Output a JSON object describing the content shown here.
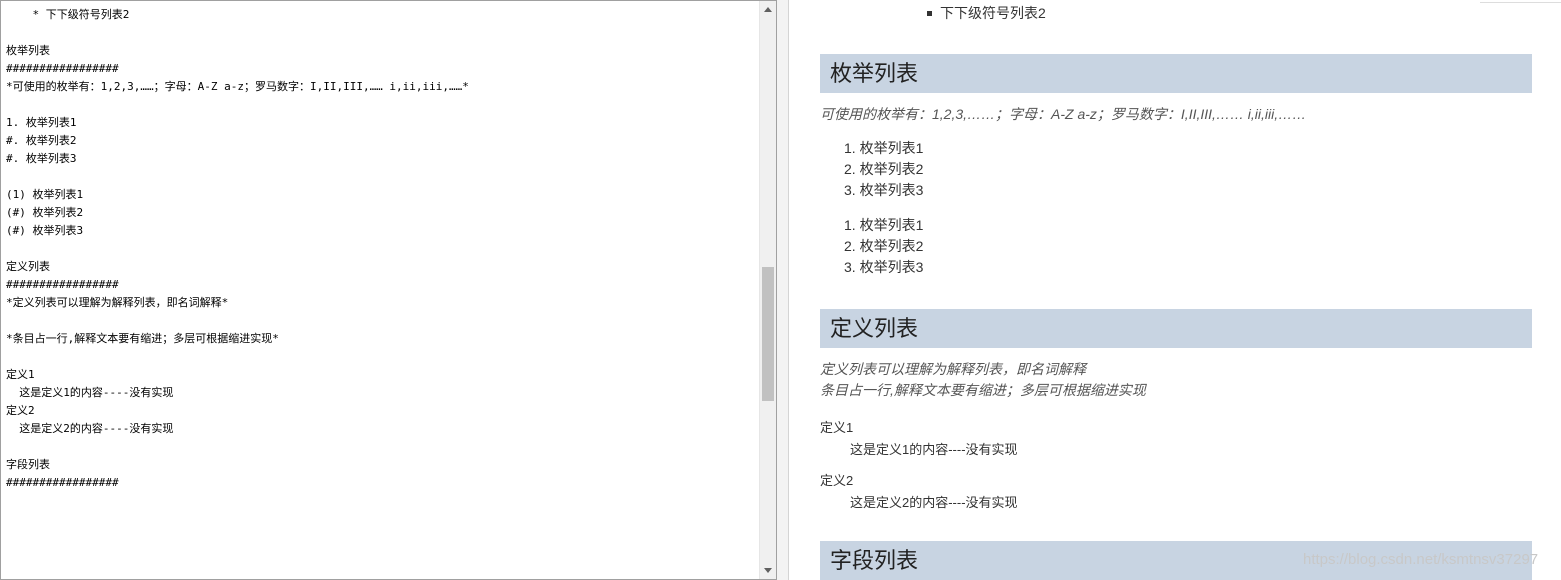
{
  "editor": {
    "lines": [
      "    * 下下级符号列表2",
      "",
      "枚举列表",
      "#################",
      "*可使用的枚举有：1,2,3,……；字母：A-Z a-z；罗马数字：I,II,III,…… i,ii,iii,……*",
      "",
      "1. 枚举列表1",
      "#. 枚举列表2",
      "#. 枚举列表3",
      "",
      "(1) 枚举列表1",
      "(#) 枚举列表2",
      "(#) 枚举列表3",
      "",
      "定义列表",
      "#################",
      "*定义列表可以理解为解释列表，即名词解释*",
      "",
      "*条目占一行,解释文本要有缩进；多层可根据缩进实现*",
      "",
      "定义1",
      "  这是定义1的内容----没有实现",
      "定义2",
      "  这是定义2的内容----没有实现",
      "",
      "字段列表",
      "#################"
    ]
  },
  "preview": {
    "bullet_item": "下下级符号列表2",
    "section1": {
      "heading": "枚举列表",
      "note": "可使用的枚举有：1,2,3,……；字母：A-Z a-z；罗马数字：I,II,III,…… i,ii,iii,……",
      "list1": [
        "1. 枚举列表1",
        "2. 枚举列表2",
        "3. 枚举列表3"
      ],
      "list2": [
        "1. 枚举列表1",
        "2. 枚举列表2",
        "3. 枚举列表3"
      ]
    },
    "section2": {
      "heading": "定义列表",
      "note1": "定义列表可以理解为解释列表，即名词解释",
      "note2": "条目占一行,解释文本要有缩进；多层可根据缩进实现",
      "defs": [
        {
          "term": "定义1",
          "desc": "这是定义1的内容----没有实现"
        },
        {
          "term": "定义2",
          "desc": "这是定义2的内容----没有实现"
        }
      ]
    },
    "section3": {
      "heading": "字段列表"
    },
    "watermark": "https://blog.csdn.net/ksmtnsv37297"
  },
  "icons": {
    "scroll_up": "chevron-up-icon",
    "scroll_down": "chevron-down-icon"
  }
}
